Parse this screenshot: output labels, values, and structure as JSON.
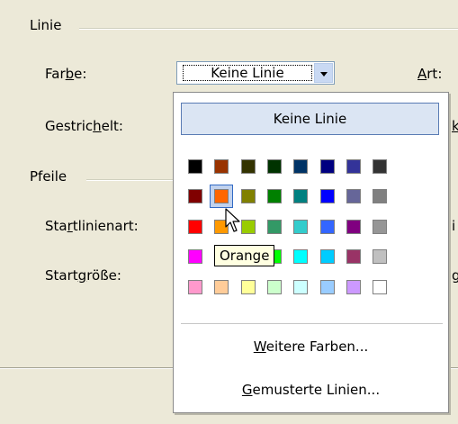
{
  "groups": {
    "line": "Linie",
    "arrows": "Pfeile"
  },
  "labels": {
    "color_pre": "Far",
    "color_u": "b",
    "color_post": "e:",
    "dash_pre": "Gestric",
    "dash_u": "h",
    "dash_post": "elt:",
    "type_u": "A",
    "type_post": "rt:",
    "start_type_pre": "Sta",
    "start_type_u": "r",
    "start_type_post": "tlinienart:",
    "start_size_pre": "Start",
    "start_size_u": "g",
    "start_size_post": "röße:",
    "right_k": "k",
    "right_i": "i",
    "right_g": "g"
  },
  "combo": {
    "value": "Keine Linie"
  },
  "popup": {
    "no_line": "Keine Linie",
    "more_colors_u": "W",
    "more_colors_post": "eitere Farben...",
    "patterned_u": "G",
    "patterned_post": "emusterte Linien..."
  },
  "tooltip": "Orange",
  "palette": [
    [
      "#000000",
      "#993300",
      "#333300",
      "#003300",
      "#003366",
      "#000080",
      "#333399",
      "#333333"
    ],
    [
      "#800000",
      "#ff6600",
      "#808000",
      "#008000",
      "#008080",
      "#0000ff",
      "#666699",
      "#808080"
    ],
    [
      "#ff0000",
      "#ff9900",
      "#99cc00",
      "#339966",
      "#33cccc",
      "#3366ff",
      "#800080",
      "#969696"
    ],
    [
      "#ff00ff",
      "#ffcc00",
      "#ffff00",
      "#00ff00",
      "#00ffff",
      "#00ccff",
      "#993366",
      "#c0c0c0"
    ],
    [
      "#ff99cc",
      "#ffcc99",
      "#ffff99",
      "#ccffcc",
      "#ccffff",
      "#99ccff",
      "#cc99ff",
      "#ffffff"
    ]
  ],
  "selected_color": "Orange"
}
